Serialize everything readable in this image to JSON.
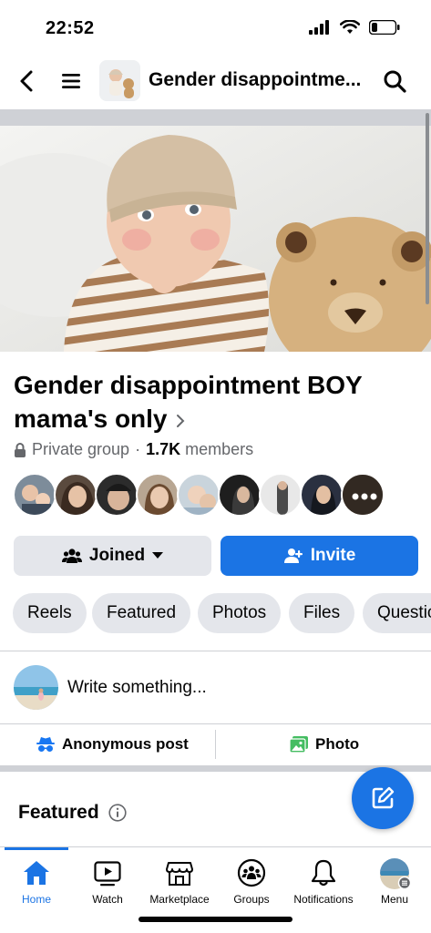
{
  "status_bar": {
    "time": "22:52"
  },
  "nav": {
    "title": "Gender disappointme..."
  },
  "group": {
    "name": "Gender disappointment BOY mama's only",
    "privacy": "Private group",
    "separator": "·",
    "member_count": "1.7K",
    "members_label": "members"
  },
  "buttons": {
    "joined": "Joined",
    "invite": "Invite"
  },
  "chips": [
    "Reels",
    "Featured",
    "Photos",
    "Files",
    "Questic"
  ],
  "composer": {
    "placeholder": "Write something..."
  },
  "actions": {
    "anonymous": "Anonymous post",
    "photo": "Photo"
  },
  "featured": {
    "title": "Featured"
  },
  "bottom_nav": {
    "tabs": [
      {
        "label": "Home"
      },
      {
        "label": "Watch"
      },
      {
        "label": "Marketplace"
      },
      {
        "label": "Groups"
      },
      {
        "label": "Notifications"
      },
      {
        "label": "Menu"
      }
    ]
  },
  "colors": {
    "brand_blue": "#1b74e4",
    "chip_gray": "#e4e6eb",
    "meta_gray": "#65676b"
  }
}
